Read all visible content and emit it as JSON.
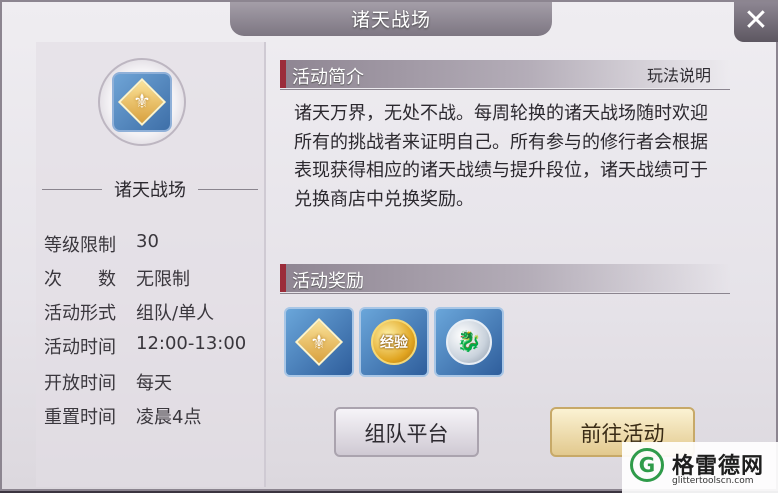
{
  "window": {
    "title": "诸天战场",
    "close_label": "✕"
  },
  "left": {
    "name": "诸天战场",
    "info": [
      {
        "label": "等级限制",
        "value": "30"
      },
      {
        "label": "次　　数",
        "value": "无限制"
      },
      {
        "label": "活动形式",
        "value": "组队/单人"
      },
      {
        "label": "活动时间",
        "value": "12:00-13:00"
      },
      {
        "label": "开放时间",
        "value": "每天"
      },
      {
        "label": "重置时间",
        "value": "凌晨4点"
      }
    ]
  },
  "intro": {
    "title": "活动简介",
    "rules_link": "玩法说明",
    "text": "诸天万界，无处不战。每周轮换的诸天战场随时欢迎所有的挑战者来证明自己。所有参与的修行者会根据表现获得相应的诸天战绩与提升段位，诸天战绩可于兑换商店中兑换奖励。"
  },
  "rewards": {
    "title": "活动奖励",
    "items": [
      {
        "icon": "fleur-token-icon",
        "label": ""
      },
      {
        "icon": "exp-coin-icon",
        "label": "经验"
      },
      {
        "icon": "silver-dragon-coin-icon",
        "label": ""
      }
    ]
  },
  "buttons": {
    "team": "组队平台",
    "go": "前往活动"
  },
  "watermark": {
    "logo": "G",
    "name": "格雷德网",
    "url": "glittertoolscn.com"
  },
  "colors": {
    "accent_red": "#9b2c3a",
    "gold": "#d8a03d",
    "blue_slot": "#3e6fa8"
  }
}
